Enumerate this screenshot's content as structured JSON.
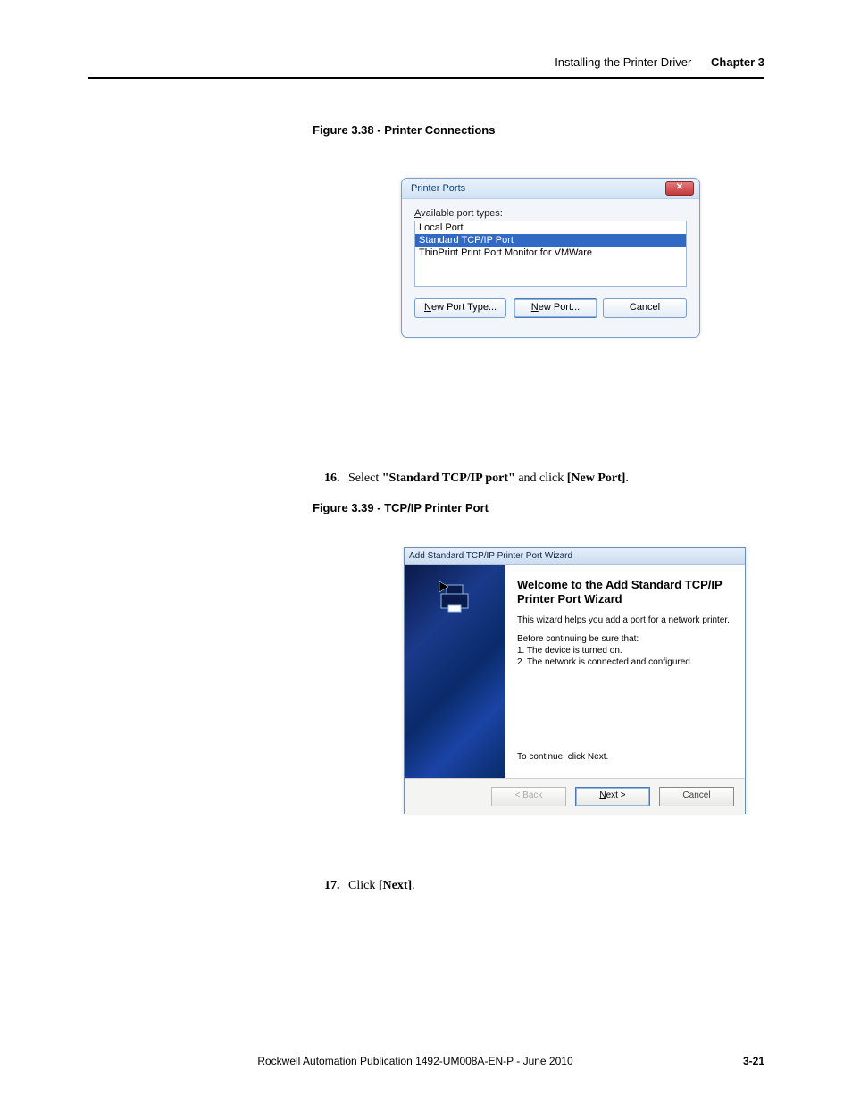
{
  "header": {
    "left": "Installing the Printer Driver",
    "chapter": "Chapter 3"
  },
  "fig338_caption": "Figure 3.38 - Printer Connections",
  "fig339_caption": "Figure 3.39 - TCP/IP Printer Port",
  "step16": {
    "num": "16.",
    "t1": "Select ",
    "bold1": "\"Standard TCP/IP port\"",
    "t2": " and click ",
    "bold2": "[New Port]",
    "t3": "."
  },
  "step17": {
    "num": "17.",
    "t1": "Click ",
    "bold1": "[Next]",
    "t2": "."
  },
  "dlg1": {
    "title": "Printer Ports",
    "close_glyph": "✕",
    "available_label": "Available port types:",
    "items": [
      "Local Port",
      "Standard TCP/IP Port",
      "ThinPrint Print Port Monitor for VMWare"
    ],
    "btn_newtype": "New Port Type...",
    "btn_newport": "New Port...",
    "btn_cancel": "Cancel"
  },
  "dlg2": {
    "title": "Add Standard TCP/IP Printer Port Wizard",
    "heading": "Welcome to the Add Standard TCP/IP Printer Port Wizard",
    "p1": "This wizard helps you add a port for a network printer.",
    "p2": "Before continuing be sure that:",
    "li1": "1.  The device is turned on.",
    "li2": "2.  The network is connected and configured.",
    "cont": "To continue, click Next.",
    "btn_back": "< Back",
    "btn_next": "Next >",
    "btn_cancel": "Cancel"
  },
  "footer": {
    "pub": "Rockwell Automation Publication 1492-UM008A-EN-P - June 2010",
    "pagenum": "3-21"
  }
}
